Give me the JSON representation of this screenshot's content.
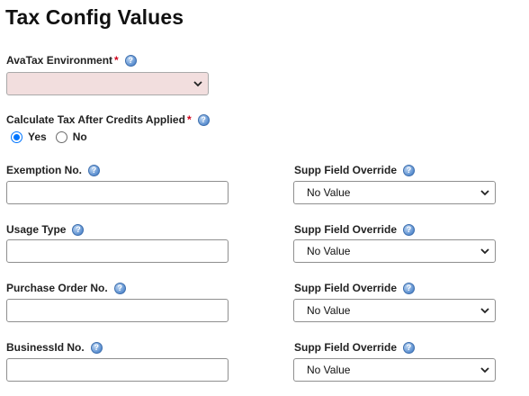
{
  "page_title": "Tax Config Values",
  "avatax_env": {
    "label": "AvaTax Environment",
    "required_mark": "*",
    "value": ""
  },
  "calc_after_credits": {
    "label": "Calculate Tax After Credits Applied",
    "required_mark": "*",
    "options": [
      {
        "label": "Yes",
        "checked": true
      },
      {
        "label": "No",
        "checked": false
      }
    ]
  },
  "fields": [
    {
      "label": "Exemption No.",
      "value": "",
      "override_label": "Supp Field Override",
      "override_value": "No Value"
    },
    {
      "label": "Usage Type",
      "value": "",
      "override_label": "Supp Field Override",
      "override_value": "No Value"
    },
    {
      "label": "Purchase Order No.",
      "value": "",
      "override_label": "Supp Field Override",
      "override_value": "No Value"
    },
    {
      "label": "BusinessId No.",
      "value": "",
      "override_label": "Supp Field Override",
      "override_value": "No Value"
    }
  ],
  "icons": {
    "help": "help-icon",
    "dropdown": "chevron-down-icon"
  },
  "colors": {
    "required": "#d0021b",
    "radio_accent": "#0075ff",
    "env_select_bg": "#f2dede"
  }
}
